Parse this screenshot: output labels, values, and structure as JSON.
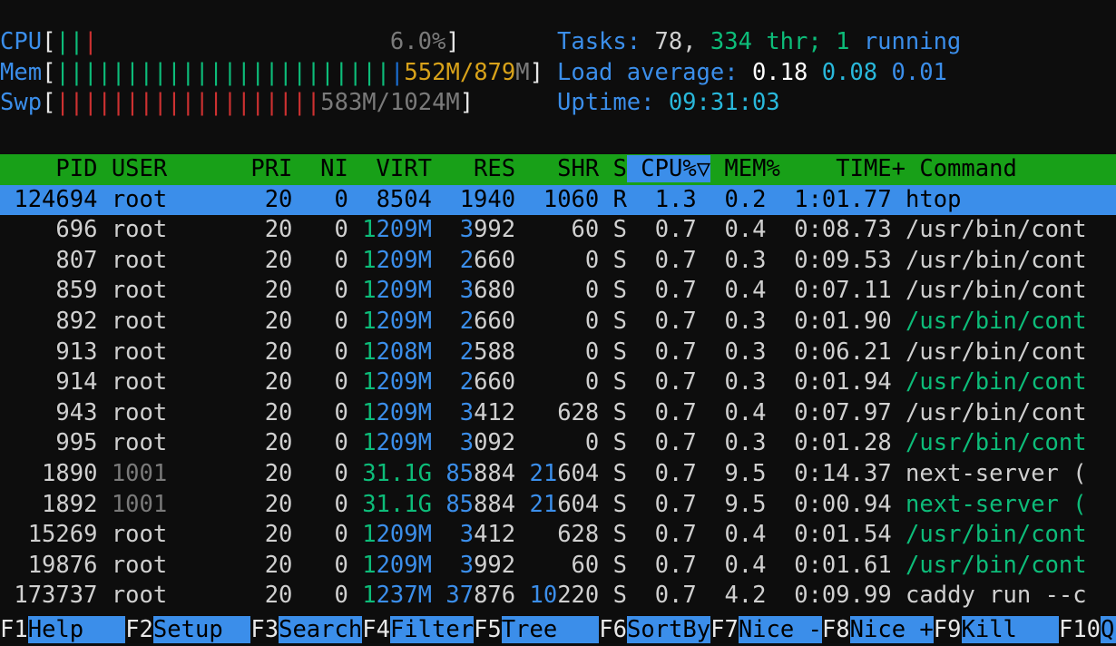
{
  "app": {
    "name": "htop",
    "terminal_cols": 70,
    "terminal_rows": 21
  },
  "colors": {
    "background": "#0d0d0d",
    "accent_blue": "#3b8eea",
    "header_green": "#18a018",
    "bar_green": "#0dbc79",
    "bar_red": "#cd3131",
    "bar_blue": "#1b6fd4",
    "text_white": "#d0d0d0",
    "text_dim": "#7a7a7a",
    "value_yellow": "#d8a21a"
  },
  "meters": {
    "cpu": {
      "label": "CPU",
      "open": "[",
      "close": "]",
      "bars_green": 2,
      "bars_red": 1,
      "bar_cells": 28,
      "value": "6.0%",
      "value_color": "grey"
    },
    "mem": {
      "label": "Mem",
      "open": "[",
      "close": "]",
      "bars_green": 24,
      "bars_blue": 1,
      "bar_cells": 28,
      "value_used": "552M",
      "value_sep": "/",
      "value_total": "879M",
      "value_color": "orange"
    },
    "swp": {
      "label": "Swp",
      "open": "[",
      "close": "]",
      "bars_red": 19,
      "bar_cells": 28,
      "value_used": "583M",
      "value_sep": "/",
      "value_total": "1024M",
      "value_color": "grey"
    }
  },
  "summary": {
    "tasks_label": "Tasks:",
    "tasks_count": "78,",
    "threads_count": "334",
    "threads_label": "thr;",
    "running_count": "1",
    "running_label": "running",
    "load_label": "Load average:",
    "load_1": "0.18",
    "load_5": "0.08",
    "load_15": "0.01",
    "uptime_label": "Uptime:",
    "uptime_value": "09:31:03"
  },
  "table": {
    "columns": [
      {
        "key": "pid",
        "label": "PID",
        "width": 7,
        "align": "right"
      },
      {
        "key": "user",
        "label": "USER",
        "width": 10,
        "align": "left"
      },
      {
        "key": "pri",
        "label": "PRI",
        "width": 4,
        "align": "right"
      },
      {
        "key": "ni",
        "label": "NI",
        "width": 4,
        "align": "right"
      },
      {
        "key": "virt",
        "label": "VIRT",
        "width": 6,
        "align": "right"
      },
      {
        "key": "res",
        "label": "RES",
        "width": 6,
        "align": "right"
      },
      {
        "key": "shr",
        "label": "SHR",
        "width": 6,
        "align": "right"
      },
      {
        "key": "s",
        "label": "S",
        "width": 2,
        "align": "right"
      },
      {
        "key": "cpu",
        "label": "CPU%",
        "width": 5,
        "align": "right"
      },
      {
        "key": "mem",
        "label": "MEM%",
        "width": 5,
        "align": "right"
      },
      {
        "key": "time",
        "label": "TIME+",
        "width": 9,
        "align": "right"
      },
      {
        "key": "command",
        "label": "Command",
        "width": 0,
        "align": "left"
      }
    ],
    "sort_column": "CPU%",
    "sort_indicator": "▽",
    "rows": [
      {
        "pid": "124694",
        "user": "root",
        "user_dim": false,
        "pri": "20",
        "ni": "0",
        "virt": "8504",
        "virt_hi": 1,
        "res": "1940",
        "res_hi": 1,
        "shr": "1060",
        "shr_hi": 1,
        "s": "R",
        "cpu": "1.3",
        "mem": "0.2",
        "time": "1:01.77",
        "command": "htop",
        "command_green": false,
        "selected": true
      },
      {
        "pid": "696",
        "user": "root",
        "user_dim": false,
        "pri": "20",
        "ni": "0",
        "virt": "1209M",
        "virt_hi": 1,
        "res": "3992",
        "res_hi": 1,
        "shr": "60",
        "shr_hi": 0,
        "s": "S",
        "cpu": "0.7",
        "mem": "0.4",
        "time": "0:08.73",
        "command": "/usr/bin/cont",
        "command_green": false,
        "selected": false
      },
      {
        "pid": "807",
        "user": "root",
        "user_dim": false,
        "pri": "20",
        "ni": "0",
        "virt": "1209M",
        "virt_hi": 1,
        "res": "2660",
        "res_hi": 1,
        "shr": "0",
        "shr_hi": 0,
        "s": "S",
        "cpu": "0.7",
        "mem": "0.3",
        "time": "0:09.53",
        "command": "/usr/bin/cont",
        "command_green": false,
        "selected": false
      },
      {
        "pid": "859",
        "user": "root",
        "user_dim": false,
        "pri": "20",
        "ni": "0",
        "virt": "1209M",
        "virt_hi": 1,
        "res": "3680",
        "res_hi": 1,
        "shr": "0",
        "shr_hi": 0,
        "s": "S",
        "cpu": "0.7",
        "mem": "0.4",
        "time": "0:07.11",
        "command": "/usr/bin/cont",
        "command_green": false,
        "selected": false
      },
      {
        "pid": "892",
        "user": "root",
        "user_dim": false,
        "pri": "20",
        "ni": "0",
        "virt": "1209M",
        "virt_hi": 1,
        "res": "2660",
        "res_hi": 1,
        "shr": "0",
        "shr_hi": 0,
        "s": "S",
        "cpu": "0.7",
        "mem": "0.3",
        "time": "0:01.90",
        "command": "/usr/bin/cont",
        "command_green": true,
        "selected": false
      },
      {
        "pid": "913",
        "user": "root",
        "user_dim": false,
        "pri": "20",
        "ni": "0",
        "virt": "1208M",
        "virt_hi": 1,
        "res": "2588",
        "res_hi": 1,
        "shr": "0",
        "shr_hi": 0,
        "s": "S",
        "cpu": "0.7",
        "mem": "0.3",
        "time": "0:06.21",
        "command": "/usr/bin/cont",
        "command_green": false,
        "selected": false
      },
      {
        "pid": "914",
        "user": "root",
        "user_dim": false,
        "pri": "20",
        "ni": "0",
        "virt": "1209M",
        "virt_hi": 1,
        "res": "2660",
        "res_hi": 1,
        "shr": "0",
        "shr_hi": 0,
        "s": "S",
        "cpu": "0.7",
        "mem": "0.3",
        "time": "0:01.94",
        "command": "/usr/bin/cont",
        "command_green": true,
        "selected": false
      },
      {
        "pid": "943",
        "user": "root",
        "user_dim": false,
        "pri": "20",
        "ni": "0",
        "virt": "1209M",
        "virt_hi": 1,
        "res": "3412",
        "res_hi": 1,
        "shr": "628",
        "shr_hi": 0,
        "s": "S",
        "cpu": "0.7",
        "mem": "0.4",
        "time": "0:07.97",
        "command": "/usr/bin/cont",
        "command_green": false,
        "selected": false
      },
      {
        "pid": "995",
        "user": "root",
        "user_dim": false,
        "pri": "20",
        "ni": "0",
        "virt": "1209M",
        "virt_hi": 1,
        "res": "3092",
        "res_hi": 1,
        "shr": "0",
        "shr_hi": 0,
        "s": "S",
        "cpu": "0.7",
        "mem": "0.3",
        "time": "0:01.28",
        "command": "/usr/bin/cont",
        "command_green": true,
        "selected": false
      },
      {
        "pid": "1890",
        "user": "1001",
        "user_dim": true,
        "pri": "20",
        "ni": "0",
        "virt": "31.1G",
        "virt_hi": 5,
        "res": "85884",
        "res_hi": 2,
        "shr": "21604",
        "shr_hi": 2,
        "s": "S",
        "cpu": "0.7",
        "mem": "9.5",
        "time": "0:14.37",
        "command": "next-server (",
        "command_green": false,
        "selected": false
      },
      {
        "pid": "1892",
        "user": "1001",
        "user_dim": true,
        "pri": "20",
        "ni": "0",
        "virt": "31.1G",
        "virt_hi": 5,
        "res": "85884",
        "res_hi": 2,
        "shr": "21604",
        "shr_hi": 2,
        "s": "S",
        "cpu": "0.7",
        "mem": "9.5",
        "time": "0:00.94",
        "command": "next-server (",
        "command_green": true,
        "selected": false
      },
      {
        "pid": "15269",
        "user": "root",
        "user_dim": false,
        "pri": "20",
        "ni": "0",
        "virt": "1209M",
        "virt_hi": 1,
        "res": "3412",
        "res_hi": 1,
        "shr": "628",
        "shr_hi": 0,
        "s": "S",
        "cpu": "0.7",
        "mem": "0.4",
        "time": "0:01.54",
        "command": "/usr/bin/cont",
        "command_green": true,
        "selected": false
      },
      {
        "pid": "19876",
        "user": "root",
        "user_dim": false,
        "pri": "20",
        "ni": "0",
        "virt": "1209M",
        "virt_hi": 1,
        "res": "3992",
        "res_hi": 1,
        "shr": "60",
        "shr_hi": 0,
        "s": "S",
        "cpu": "0.7",
        "mem": "0.4",
        "time": "0:01.61",
        "command": "/usr/bin/cont",
        "command_green": true,
        "selected": false
      },
      {
        "pid": "173737",
        "user": "root",
        "user_dim": false,
        "pri": "20",
        "ni": "0",
        "virt": "1237M",
        "virt_hi": 1,
        "res": "37876",
        "res_hi": 2,
        "shr": "10220",
        "shr_hi": 2,
        "s": "S",
        "cpu": "0.7",
        "mem": "4.2",
        "time": "0:09.99",
        "command": "caddy run --c",
        "command_green": false,
        "selected": false
      }
    ]
  },
  "function_bar": [
    {
      "key": "F1",
      "label": "Help"
    },
    {
      "key": "F2",
      "label": "Setup"
    },
    {
      "key": "F3",
      "label": "Search"
    },
    {
      "key": "F4",
      "label": "Filter"
    },
    {
      "key": "F5",
      "label": "Tree"
    },
    {
      "key": "F6",
      "label": "SortBy"
    },
    {
      "key": "F7",
      "label": "Nice -"
    },
    {
      "key": "F8",
      "label": "Nice +"
    },
    {
      "key": "F9",
      "label": "Kill"
    },
    {
      "key": "F10",
      "label": "Qui"
    }
  ]
}
